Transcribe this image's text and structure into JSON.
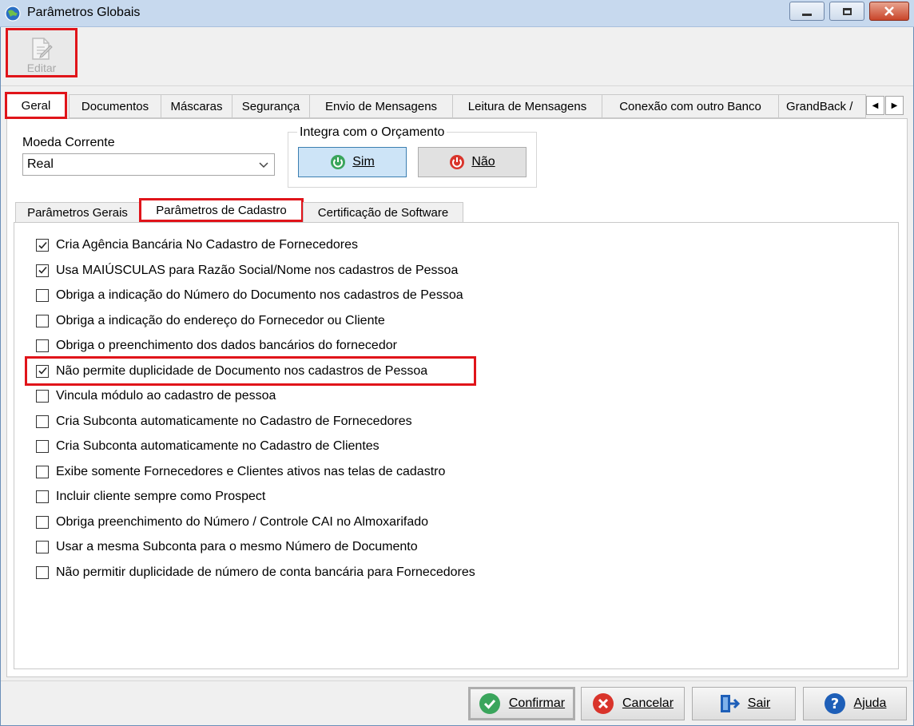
{
  "window": {
    "title": "Parâmetros Globais",
    "icon": "globe-icon"
  },
  "toolbar": {
    "edit_label": "Editar",
    "edit_icon": "edit-document-icon"
  },
  "main_tabs": [
    "Geral",
    "Documentos",
    "Máscaras",
    "Segurança",
    "Envio de Mensagens",
    "Leitura de Mensagens",
    "Conexão com outro Banco",
    "GrandBack /"
  ],
  "active_main_tab": "Geral",
  "currency": {
    "label": "Moeda Corrente",
    "value": "Real"
  },
  "integra": {
    "title": "Integra com o Orçamento",
    "sim_label": "Sim",
    "nao_label": "Não",
    "selected": "Sim"
  },
  "sub_tabs": [
    "Parâmetros Gerais",
    "Parâmetros de Cadastro",
    "Certificação de Software"
  ],
  "active_sub_tab": "Parâmetros de Cadastro",
  "options": [
    {
      "label": "Cria Agência Bancária No Cadastro de Fornecedores",
      "checked": true
    },
    {
      "label": "Usa MAIÚSCULAS para Razão Social/Nome nos cadastros de Pessoa",
      "checked": true
    },
    {
      "label": "Obriga a indicação do Número do Documento nos cadastros de Pessoa",
      "checked": false
    },
    {
      "label": "Obriga a indicação do endereço do Fornecedor ou Cliente",
      "checked": false
    },
    {
      "label": "Obriga o preenchimento dos dados bancários do fornecedor",
      "checked": false
    },
    {
      "label": "Não permite duplicidade de Documento nos cadastros de Pessoa",
      "checked": true
    },
    {
      "label": "Vincula módulo ao cadastro de pessoa",
      "checked": false
    },
    {
      "label": "Cria Subconta automaticamente no Cadastro de Fornecedores",
      "checked": false
    },
    {
      "label": "Cria Subconta automaticamente no Cadastro de Clientes",
      "checked": false
    },
    {
      "label": "Exibe somente Fornecedores e Clientes ativos nas telas de cadastro",
      "checked": false
    },
    {
      "label": "Incluir cliente sempre como Prospect",
      "checked": false
    },
    {
      "label": "Obriga preenchimento do Número / Controle CAI no Almoxarifado",
      "checked": false
    },
    {
      "label": "Usar a mesma Subconta para o mesmo Número de Documento",
      "checked": false
    },
    {
      "label": "Não permitir duplicidade de número de conta bancária para Fornecedores",
      "checked": false
    }
  ],
  "footer": {
    "confirm_label": "Confirmar",
    "cancel_label": "Cancelar",
    "exit_label": "Sair",
    "help_label": "Ajuda"
  },
  "colors": {
    "highlight": "#e0141a",
    "confirm_green": "#3aa55c",
    "cancel_red": "#d9342b",
    "help_blue": "#1e5fb8"
  }
}
